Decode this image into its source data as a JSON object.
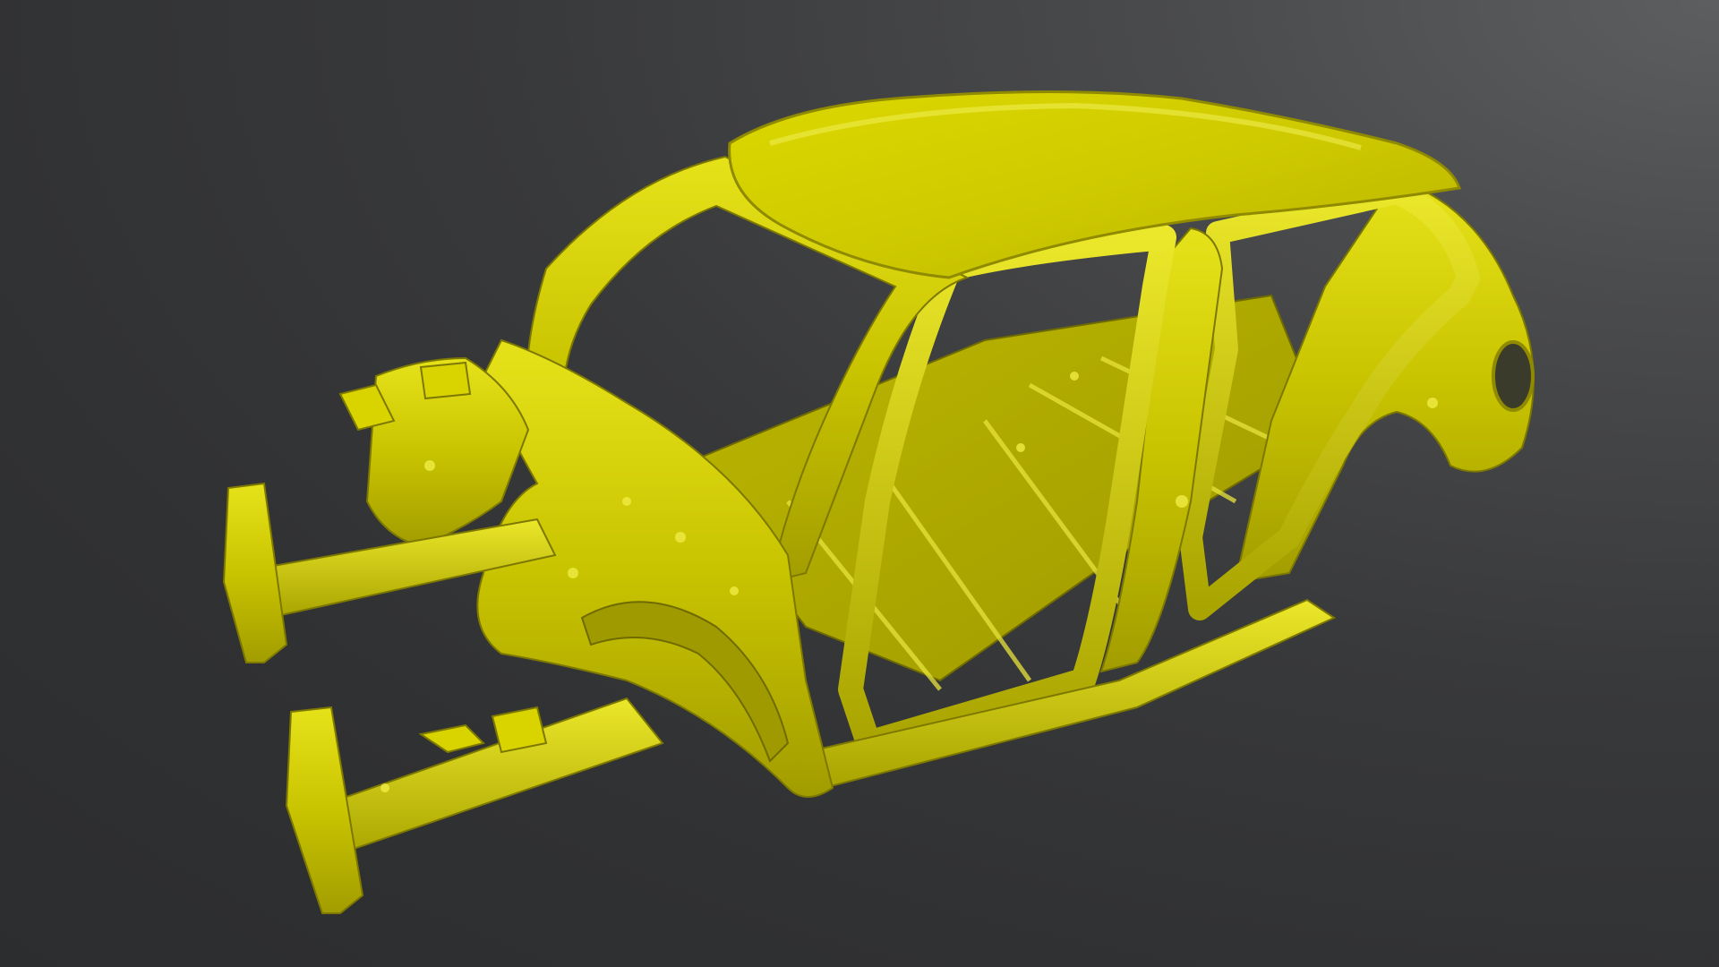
{
  "scene": {
    "subject": "car-body-in-white",
    "model_color": "#d4cf00",
    "model_highlight": "#f2ee4a",
    "model_shadow": "#8f8a00",
    "background_light": "#5d5e60",
    "background_dark": "#2c2d2f"
  }
}
